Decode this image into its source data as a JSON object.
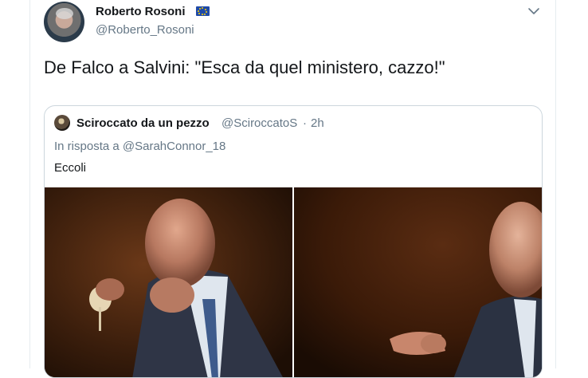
{
  "tweet": {
    "display_name": "Roberto Rosoni",
    "handle": "@Roberto_Rosoni",
    "text": "De Falco a Salvini: \"Esca da quel ministero, cazzo!\"",
    "badge_icon": "eu-flag-icon",
    "menu_icon": "chevron-down-icon"
  },
  "quoted": {
    "display_name": "Sciroccato da un pezzo",
    "handle": "@SciroccatoS",
    "separator": "·",
    "time": "2h",
    "reply_prefix": "In risposta a",
    "reply_mention": "@SarahConnor_18",
    "text": "Eccoli"
  },
  "colors": {
    "text": "#14171a",
    "secondary": "#657786",
    "border": "#ccd6dd",
    "flag_blue": "#1f4aa8",
    "flag_star": "#ffd400"
  }
}
